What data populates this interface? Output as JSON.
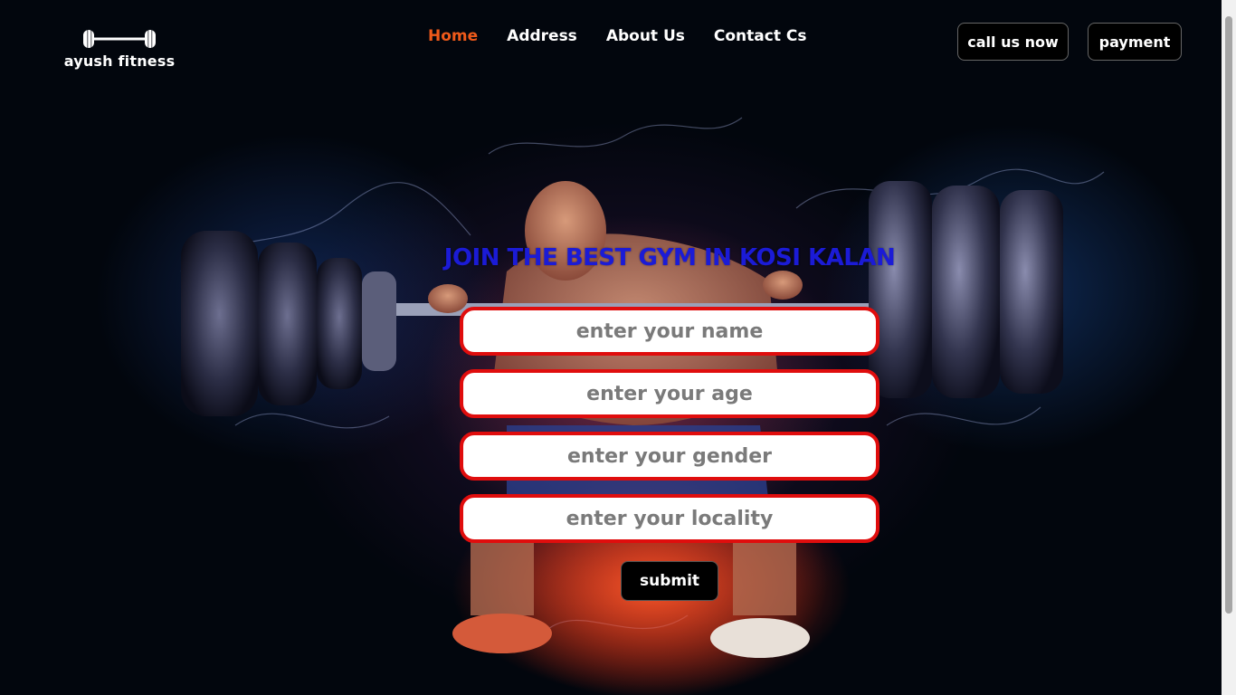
{
  "brand": {
    "name": "ayush fitness",
    "icon": "dumbbell-icon"
  },
  "nav": {
    "items": [
      {
        "label": "Home",
        "active": true
      },
      {
        "label": "Address",
        "active": false
      },
      {
        "label": "About Us",
        "active": false
      },
      {
        "label": "Contact Cs",
        "active": false
      }
    ]
  },
  "header_buttons": {
    "call": "call us now",
    "payment": "payment"
  },
  "form": {
    "headline": "JOIN THE BEST GYM IN KOSI KALAN",
    "fields": {
      "name": {
        "placeholder": "enter your name",
        "value": ""
      },
      "age": {
        "placeholder": "enter your age",
        "value": ""
      },
      "gender": {
        "placeholder": "enter your gender",
        "value": ""
      },
      "locality": {
        "placeholder": "enter your locality",
        "value": ""
      }
    },
    "submit": "submit"
  },
  "colors": {
    "active_nav": "#ef5a1a",
    "headline": "#1b1bd6",
    "field_border": "#e00d0d",
    "background": "#02060d"
  }
}
